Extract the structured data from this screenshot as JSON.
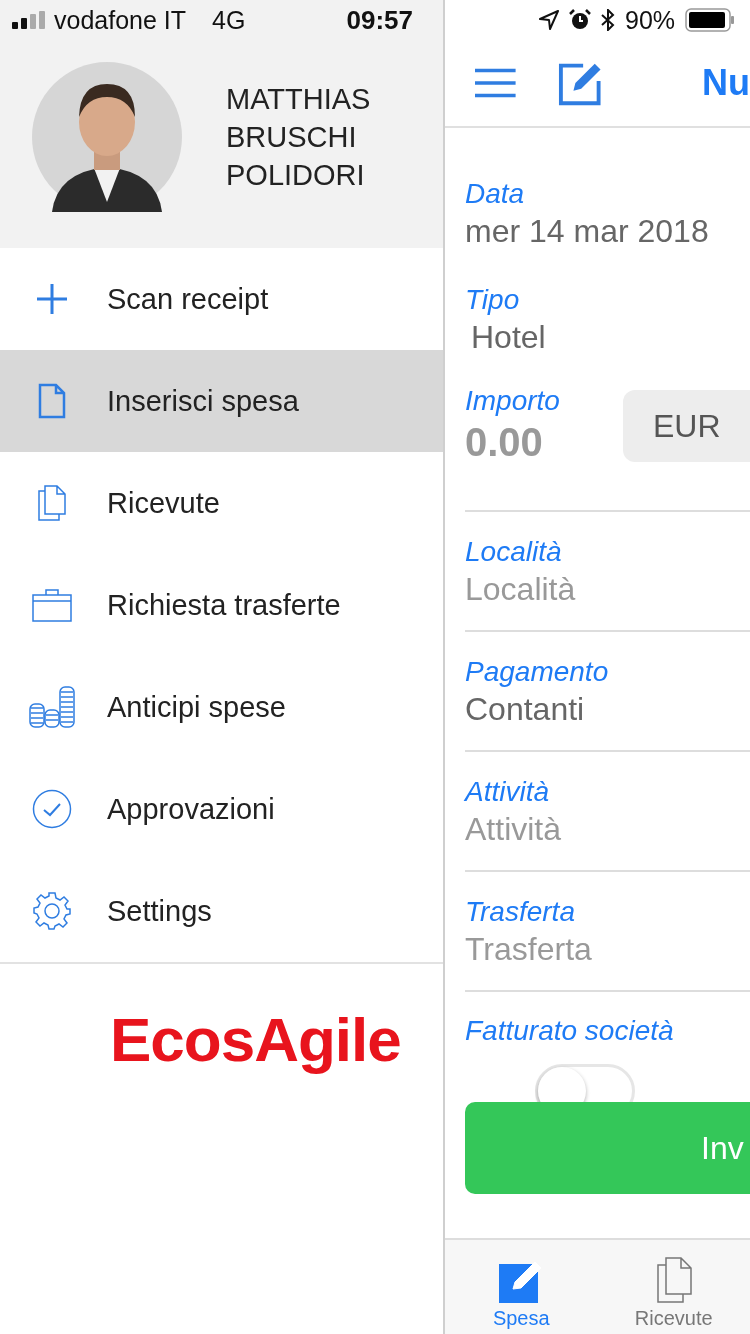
{
  "status_bar": {
    "carrier": "vodafone IT",
    "network": "4G",
    "time": "09:57",
    "battery": "90%"
  },
  "drawer": {
    "user_name": "MATTHIAS BRUSCHI POLIDORI",
    "items": [
      {
        "label": "Scan receipt",
        "kind": "plus",
        "selected": false
      },
      {
        "label": "Inserisci spesa",
        "kind": "document",
        "selected": true
      },
      {
        "label": "Ricevute",
        "kind": "documents",
        "selected": false
      },
      {
        "label": "Richiesta trasferte",
        "kind": "briefcase",
        "selected": false
      },
      {
        "label": "Anticipi spese",
        "kind": "coins",
        "selected": false
      },
      {
        "label": "Approvazioni",
        "kind": "check",
        "selected": false
      },
      {
        "label": "Settings",
        "kind": "gear",
        "selected": false
      }
    ],
    "logo": "EcosAgile"
  },
  "nav_bar": {
    "title": "Nu"
  },
  "form": {
    "fields": [
      {
        "label": "Data",
        "value": "mer 14 mar 2018"
      },
      {
        "label": "Tipo",
        "value": "Hotel"
      },
      {
        "label": "Importo",
        "placeholder": "0.00",
        "currency": "EUR"
      },
      {
        "label": "Località",
        "placeholder": "Località"
      },
      {
        "label": "Pagamento",
        "value": "Contanti"
      },
      {
        "label": "Attività",
        "placeholder": "Attività"
      },
      {
        "label": "Trasferta",
        "placeholder": "Trasferta"
      }
    ],
    "switch": {
      "label": "Fatturato società",
      "on": false
    },
    "submit": "Inv"
  },
  "tabs": [
    {
      "label": "Spesa",
      "kind": "edit",
      "selected": true
    },
    {
      "label": "Ricevute",
      "kind": "documents",
      "selected": false
    }
  ]
}
